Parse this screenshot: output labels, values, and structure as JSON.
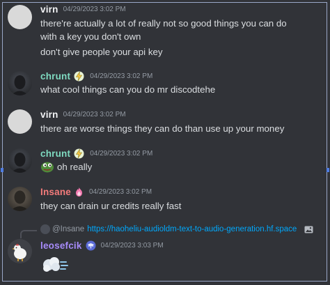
{
  "messages": [
    {
      "author": "virn",
      "author_color": "#f2f3f5",
      "timestamp": "04/29/2023 3:02 PM",
      "lines": [
        "there're actually a lot of really not so good things you can do",
        "with a key you don't own",
        "don't give people your api key"
      ]
    },
    {
      "author": "chrunt",
      "author_color": "#7fdbc1",
      "badge": "bolt-icon",
      "timestamp": "04/29/2023 3:02 PM",
      "lines": [
        "what cool things can you do mr discodtehe"
      ]
    },
    {
      "author": "virn",
      "author_color": "#f2f3f5",
      "timestamp": "04/29/2023 3:02 PM",
      "lines": [
        "there are worse things they can do than use up your money"
      ]
    },
    {
      "author": "chrunt",
      "author_color": "#7fdbc1",
      "badge": "bolt-icon",
      "timestamp": "04/29/2023 3:02 PM",
      "lines": [
        "oh really"
      ],
      "emoji": "pepe-emoji"
    },
    {
      "author": "Insane",
      "author_color": "#f47b7b",
      "badge": "flame-icon",
      "timestamp": "04/29/2023 3:02 PM",
      "lines": [
        "they can drain ur credits really fast"
      ]
    },
    {
      "reply_to": {
        "author": "@Insane",
        "text": "https://haoheliu-audioldm-text-to-audio-generation.hf.space"
      },
      "author": "leosefcik",
      "author_color": "#a78bfa",
      "badge": "wings-icon",
      "timestamp": "04/29/2023 3:03 PM",
      "emoji": "dash-emoji"
    }
  ]
}
